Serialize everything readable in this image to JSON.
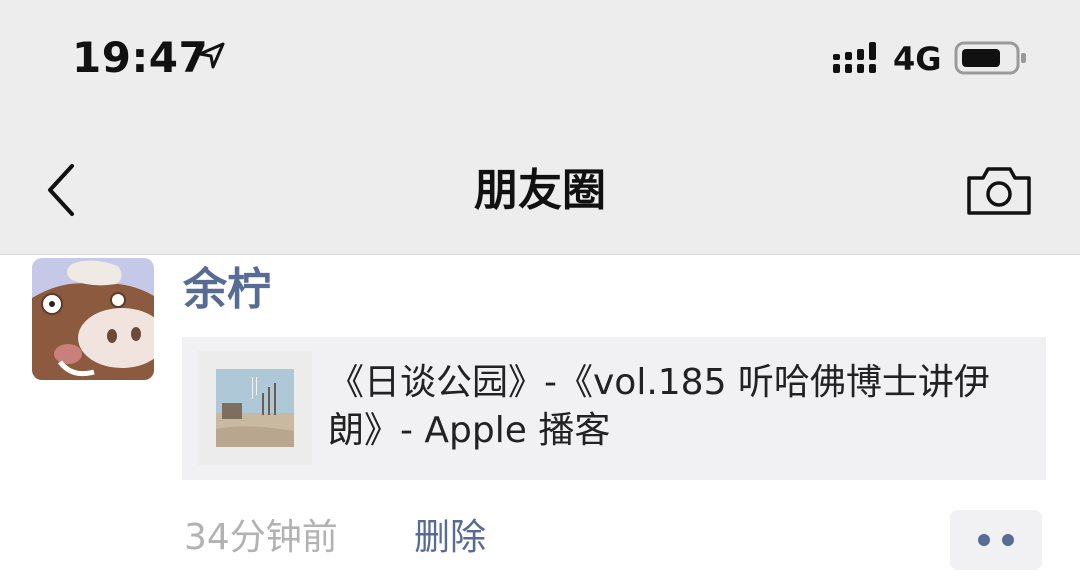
{
  "status_bar": {
    "time": "19:47",
    "network": "4G"
  },
  "nav": {
    "title": "朋友圈"
  },
  "post": {
    "author": "余柠",
    "link_title": "《日谈公园》-《vol.185 听哈佛博士讲伊朗》- Apple 播客",
    "time_ago": "34分钟前",
    "delete_label": "删除"
  },
  "colors": {
    "link_blue": "#576b95",
    "nav_bg": "#ededed",
    "card_bg": "#f1f1f3"
  },
  "icons": {
    "location": "location-arrow-icon",
    "signal": "cellular-signal-icon",
    "battery": "battery-icon",
    "back": "chevron-left-icon",
    "camera": "camera-icon",
    "more": "more-dots-icon"
  }
}
